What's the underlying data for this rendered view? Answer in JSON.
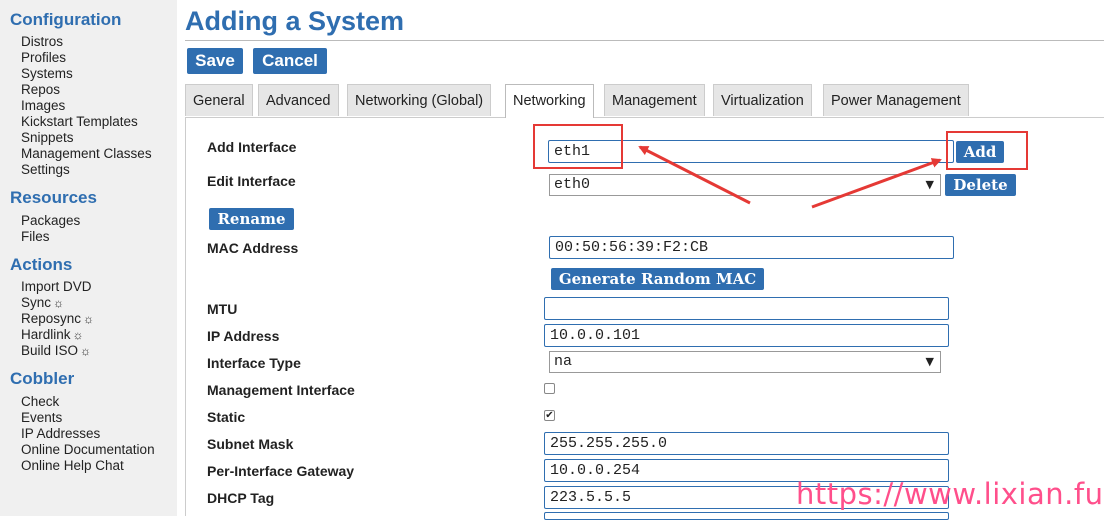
{
  "sidebar": {
    "configuration": {
      "heading": "Configuration",
      "items": [
        "Distros",
        "Profiles",
        "Systems",
        "Repos",
        "Images",
        "Kickstart Templates",
        "Snippets",
        "Management Classes",
        "Settings"
      ]
    },
    "resources": {
      "heading": "Resources",
      "items": [
        "Packages",
        "Files"
      ]
    },
    "actions": {
      "heading": "Actions",
      "items": [
        "Import DVD",
        "Sync",
        "Reposync",
        "Hardlink",
        "Build ISO"
      ],
      "gear_glyph": "☼"
    },
    "cobbler": {
      "heading": "Cobbler",
      "items": [
        "Check",
        "Events",
        "IP Addresses",
        "Online Documentation",
        "Online Help Chat"
      ]
    }
  },
  "page": {
    "title": "Adding a System",
    "save_label": "Save",
    "cancel_label": "Cancel"
  },
  "tabs": [
    {
      "label": "General"
    },
    {
      "label": "Advanced"
    },
    {
      "label": "Networking (Global)"
    },
    {
      "label": "Networking",
      "active": true
    },
    {
      "label": "Management"
    },
    {
      "label": "Virtualization"
    },
    {
      "label": "Power Management"
    }
  ],
  "form": {
    "add_interface": {
      "label": "Add Interface",
      "value": "eth1",
      "button": "Add"
    },
    "edit_interface": {
      "label": "Edit Interface",
      "value": "eth0",
      "button": "Delete"
    },
    "rename_button": "Rename",
    "mac_address": {
      "label": "MAC Address",
      "value": "00:50:56:39:F2:CB",
      "button": "Generate Random MAC"
    },
    "mtu": {
      "label": "MTU",
      "value": ""
    },
    "ip_address": {
      "label": "IP Address",
      "value": "10.0.0.101"
    },
    "interface_type": {
      "label": "Interface Type",
      "value": "na"
    },
    "management_interface": {
      "label": "Management Interface",
      "checked": false
    },
    "static": {
      "label": "Static",
      "checked": true
    },
    "subnet_mask": {
      "label": "Subnet Mask",
      "value": "255.255.255.0"
    },
    "gateway": {
      "label": "Per-Interface Gateway",
      "value": "10.0.0.254"
    },
    "dhcp_tag": {
      "label": "DHCP Tag",
      "value": "223.5.5.5"
    }
  },
  "watermark": "https://www.lixian.fun",
  "colors": {
    "accent": "#2f6eb0",
    "annotation_red": "#e53935",
    "watermark_pink": "#ff4f8b"
  },
  "icons": {
    "select_arrow": "▼",
    "checkmark": "✔"
  }
}
